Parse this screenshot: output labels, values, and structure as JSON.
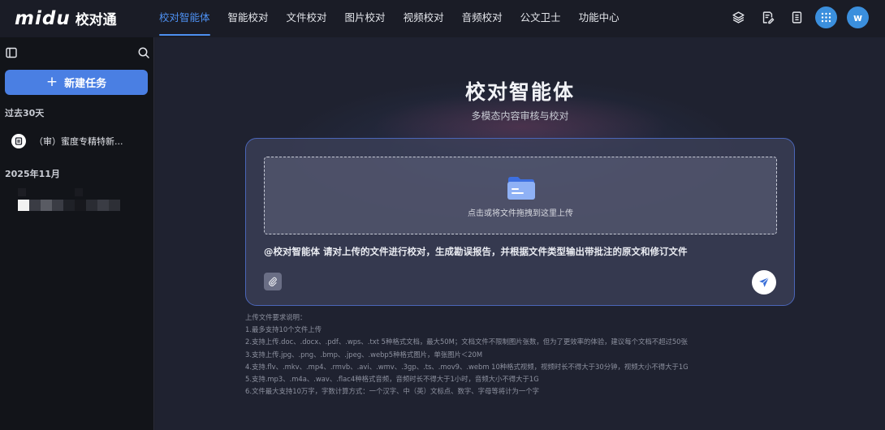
{
  "app": {
    "logo_mark": "midu",
    "logo_text": "校对通"
  },
  "nav": {
    "items": [
      {
        "label": "校对智能体",
        "active": true
      },
      {
        "label": "智能校对"
      },
      {
        "label": "文件校对"
      },
      {
        "label": "图片校对"
      },
      {
        "label": "视频校对"
      },
      {
        "label": "音频校对"
      },
      {
        "label": "公文卫士"
      },
      {
        "label": "功能中心"
      }
    ],
    "icons": [
      "layers-icon",
      "edit-doc-icon",
      "list-doc-icon",
      "apps-grid-icon"
    ],
    "avatar_initial": "w"
  },
  "sidebar": {
    "new_task_label": "新建任务",
    "section_recent": "过去30天",
    "history_item": "（审）蜜度专精特新...",
    "section_month": "2025年11月"
  },
  "main": {
    "title": "校对智能体",
    "subtitle": "多模态内容审核与校对",
    "drop_text": "点击或将文件拖拽到这里上传",
    "prompt": "@校对智能体 请对上传的文件进行校对，生成勘误报告，并根据文件类型输出带批注的原文和修订文件",
    "notes": [
      "上传文件要求说明：",
      "1.最多支持10个文件上传",
      "2.支持上传.doc、.docx、.pdf、.wps、.txt 5种格式文档，最大50M；文档文件不限制图片张数，但为了更效率的体验，建议每个文档不超过50张",
      "3.支持上传.jpg、.png、.bmp、.jpeg、.webp5种格式图片，单张图片＜20M",
      "4.支持.flv、.mkv、.mp4、.rmvb、.avi、.wmv、.3gp、.ts、.mov9、.webm 10种格式视频，视频时长不得大于30分钟，视频大小不得大于1G",
      "5.支持.mp3、.m4a、.wav、.flac4种格式音频，音频时长不得大于1小时，音频大小不得大于1G",
      "6.文件最大支持10万字，字数计算方式：一个汉字、中（英）文标点、数字、字母等将计为一个字"
    ]
  },
  "colors": {
    "accent": "#4d8ff0",
    "button": "#4a7fe3",
    "sidebar_bg": "#121419",
    "main_bg": "#1f2230"
  }
}
